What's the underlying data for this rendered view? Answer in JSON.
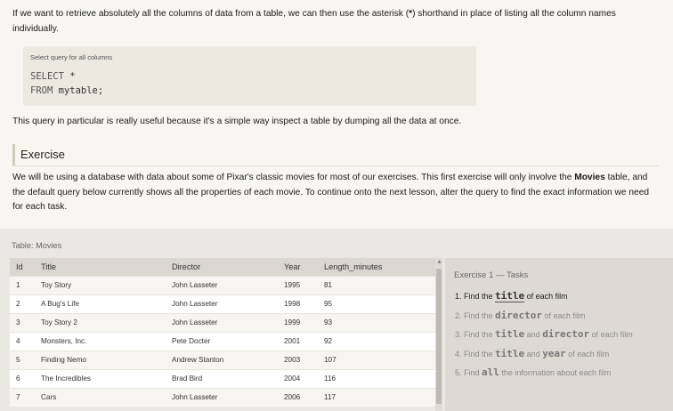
{
  "intro": {
    "p1_a": "If we want to retrieve absolutely all the columns of data from a table, we can then use the asterisk (",
    "p1_star": "*",
    "p1_b": ") shorthand in place of listing all the column names individually.",
    "code_caption": "Select query for all columns",
    "code_line1_kw": "SELECT",
    "code_line1_rest": " *",
    "code_line2_kw": "FROM",
    "code_line2_rest": " mytable;",
    "p2": "This query in particular is really useful because it's a simple way inspect a table by dumping all the data at once."
  },
  "exercise": {
    "heading": "Exercise",
    "p_a": "We will be using a database with data about some of Pixar's classic movies for most of our exercises. This first exercise will only involve the ",
    "p_bold": "Movies",
    "p_b": " table, and the default query below currently shows all the properties of each movie. To continue onto the next lesson, alter the query to find the exact information we need for each task."
  },
  "table": {
    "caption": "Table: Movies",
    "headers": [
      "Id",
      "Title",
      "Director",
      "Year",
      "Length_minutes"
    ],
    "rows": [
      [
        "1",
        "Toy Story",
        "John Lasseter",
        "1995",
        "81"
      ],
      [
        "2",
        "A Bug's Life",
        "John Lasseter",
        "1998",
        "95"
      ],
      [
        "3",
        "Toy Story 2",
        "John Lasseter",
        "1999",
        "93"
      ],
      [
        "4",
        "Monsters, Inc.",
        "Pete Docter",
        "2001",
        "92"
      ],
      [
        "5",
        "Finding Nemo",
        "Andrew Stanton",
        "2003",
        "107"
      ],
      [
        "6",
        "The Incredibles",
        "Brad Bird",
        "2004",
        "116"
      ],
      [
        "7",
        "Cars",
        "John Lasseter",
        "2006",
        "117"
      ]
    ]
  },
  "tasks": {
    "title": "Exercise 1 — Tasks",
    "items": [
      {
        "parts": [
          "1. Find the ",
          "title",
          " of each film"
        ]
      },
      {
        "parts": [
          "2. Find the ",
          "director",
          " of each film"
        ]
      },
      {
        "parts": [
          "3. Find the ",
          "title",
          " and ",
          "director",
          " of each film"
        ]
      },
      {
        "parts": [
          "4. Find the ",
          "title",
          " and ",
          "year",
          " of each film"
        ]
      },
      {
        "parts": [
          "5. Find ",
          "all",
          " the information about each film"
        ]
      }
    ]
  }
}
